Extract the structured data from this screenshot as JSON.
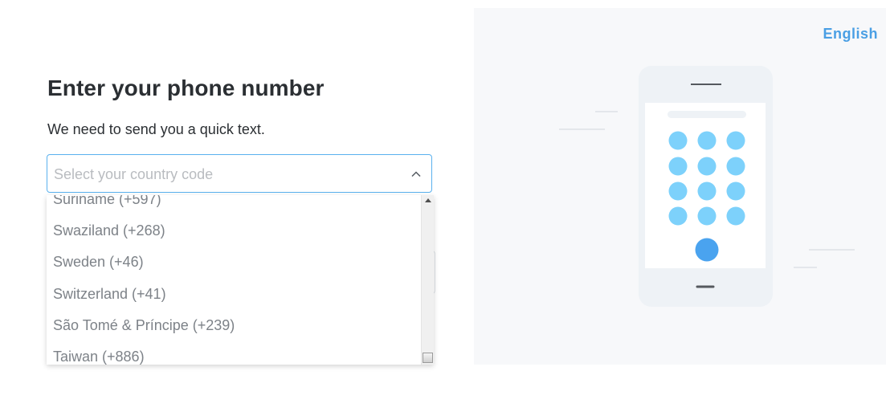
{
  "header": {
    "title": "Enter your phone number",
    "subtitle": "We need to send you a quick text."
  },
  "country_select": {
    "placeholder": "Select your country code",
    "expanded": true,
    "visible_options": [
      "Suriname (+597)",
      "Swaziland (+268)",
      "Sweden (+46)",
      "Switzerland (+41)",
      "São Tomé & Príncipe (+239)",
      "Taiwan (+886)"
    ]
  },
  "language": {
    "label": "English"
  },
  "colors": {
    "accent": "#4a9fe4",
    "input_border": "#5ab1ee",
    "keypad_dot": "#7dd1fb",
    "keypad_action": "#4aa3ef",
    "panel_bg": "#f7f8fa",
    "phone_body": "#eef2f6"
  },
  "icons": {
    "select_toggle": "chevron-up-icon",
    "illustration": "phone-keypad-illustration"
  }
}
